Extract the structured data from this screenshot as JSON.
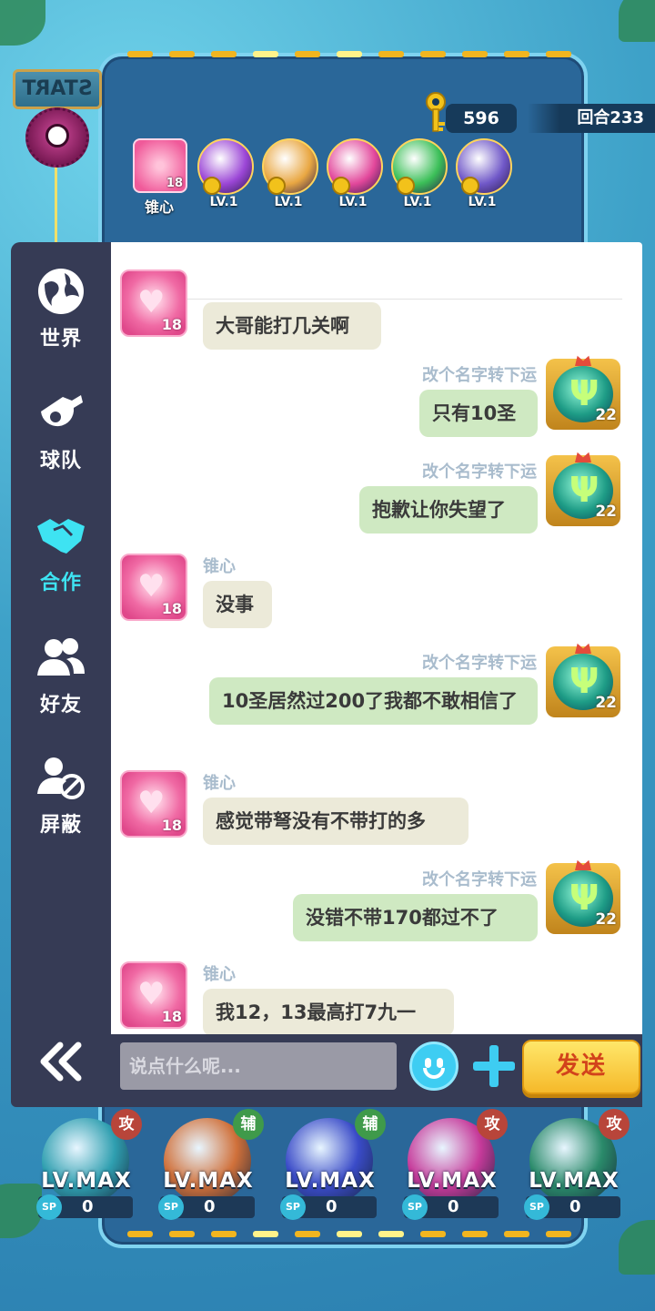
{
  "hud": {
    "start_sign": "START",
    "coins": "596",
    "round": "回合233"
  },
  "skills": {
    "player": {
      "name": "锥心",
      "level": "18"
    },
    "orbs": [
      {
        "label": "LV.1",
        "color": "#9b46d6"
      },
      {
        "label": "LV.1",
        "color": "#e9a742"
      },
      {
        "label": "LV.1",
        "color": "#e2479b"
      },
      {
        "label": "LV.1",
        "color": "#3bbf58"
      },
      {
        "label": "LV.1",
        "color": "#7058c8"
      }
    ]
  },
  "sidebar": {
    "items": [
      {
        "label": "世界",
        "icon": "globe-icon"
      },
      {
        "label": "球队",
        "icon": "whistle-icon"
      },
      {
        "label": "合作",
        "icon": "handshake-icon",
        "active": true
      },
      {
        "label": "好友",
        "icon": "friends-icon"
      },
      {
        "label": "屏蔽",
        "icon": "block-user-icon"
      }
    ],
    "collapse_icon": "double-chevron-left-icon"
  },
  "chat": {
    "messages": [
      {
        "side": "left",
        "sender": "",
        "text": "大哥能打几关啊",
        "level": "18"
      },
      {
        "side": "right",
        "sender": "改个名字转下运",
        "text": "只有10圣",
        "level": "22"
      },
      {
        "side": "right",
        "sender": "改个名字转下运",
        "text": "抱歉让你失望了",
        "level": "22"
      },
      {
        "side": "left",
        "sender": "锥心",
        "text": "没事",
        "level": "18"
      },
      {
        "side": "right",
        "sender": "改个名字转下运",
        "text": "10圣居然过200了我都不敢相信了",
        "level": "22"
      },
      {
        "side": "left",
        "sender": "锥心",
        "text": "感觉带弩没有不带打的多",
        "level": "18"
      },
      {
        "side": "right",
        "sender": "改个名字转下运",
        "text": "没错不带170都过不了",
        "level": "22"
      },
      {
        "side": "left",
        "sender": "锥心",
        "text": "我12，13最高打7九一",
        "level": "18"
      }
    ],
    "input_placeholder": "说点什么呢...",
    "send_label": "发送"
  },
  "heroes": [
    {
      "badge": "攻",
      "badge_color": "#b8453a",
      "level": "LV.MAX",
      "sp_label": "SP",
      "sp": "0",
      "color": "#2f9fb0"
    },
    {
      "badge": "辅",
      "badge_color": "#3f9a4a",
      "level": "LV.MAX",
      "sp_label": "SP",
      "sp": "0",
      "color": "#d0703a"
    },
    {
      "badge": "辅",
      "badge_color": "#3f9a4a",
      "level": "LV.MAX",
      "sp_label": "SP",
      "sp": "0",
      "color": "#3a4bc8"
    },
    {
      "badge": "攻",
      "badge_color": "#b8453a",
      "level": "LV.MAX",
      "sp_label": "SP",
      "sp": "0",
      "color": "#c63a9a"
    },
    {
      "badge": "攻",
      "badge_color": "#b8453a",
      "level": "LV.MAX",
      "sp_label": "SP",
      "sp": "0",
      "color": "#2a8a6a"
    }
  ]
}
